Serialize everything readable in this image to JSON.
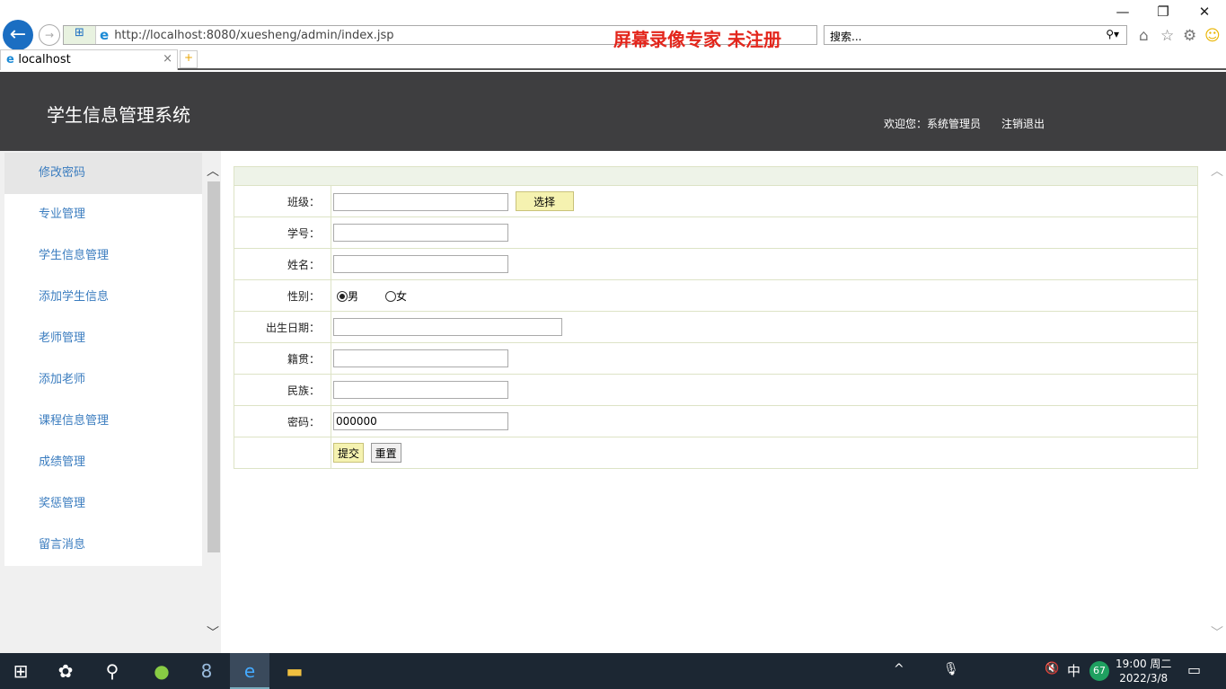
{
  "browser": {
    "url": "http://localhost:8080/xuesheng/admin/index.jsp",
    "tab_title": "localhost",
    "search_placeholder": "搜索...",
    "watermark": "屏幕录像专家 未注册"
  },
  "header": {
    "title": "学生信息管理系统",
    "welcome": "欢迎您：系统管理员",
    "logout": "注销退出"
  },
  "sidebar": {
    "items": [
      {
        "label": "修改密码"
      },
      {
        "label": "专业管理"
      },
      {
        "label": "学生信息管理"
      },
      {
        "label": "添加学生信息"
      },
      {
        "label": "老师管理"
      },
      {
        "label": "添加老师"
      },
      {
        "label": "课程信息管理"
      },
      {
        "label": "成绩管理"
      },
      {
        "label": "奖惩管理"
      },
      {
        "label": "留言消息"
      }
    ]
  },
  "form": {
    "class_label": "班级：",
    "class_value": "",
    "choose_btn": "选择",
    "id_label": "学号：",
    "id_value": "",
    "name_label": "姓名：",
    "name_value": "",
    "gender_label": "性别：",
    "gender_male": "男",
    "gender_female": "女",
    "gender_selected": "男",
    "birth_label": "出生日期：",
    "birth_value": "",
    "hometown_label": "籍贯：",
    "hometown_value": "",
    "ethnic_label": "民族：",
    "ethnic_value": "",
    "password_label": "密码：",
    "password_value": "000000",
    "submit": "提交",
    "reset": "重置"
  },
  "taskbar": {
    "time": "19:00 周二",
    "date": "2022/3/8",
    "ime": "中",
    "badge": "67"
  }
}
